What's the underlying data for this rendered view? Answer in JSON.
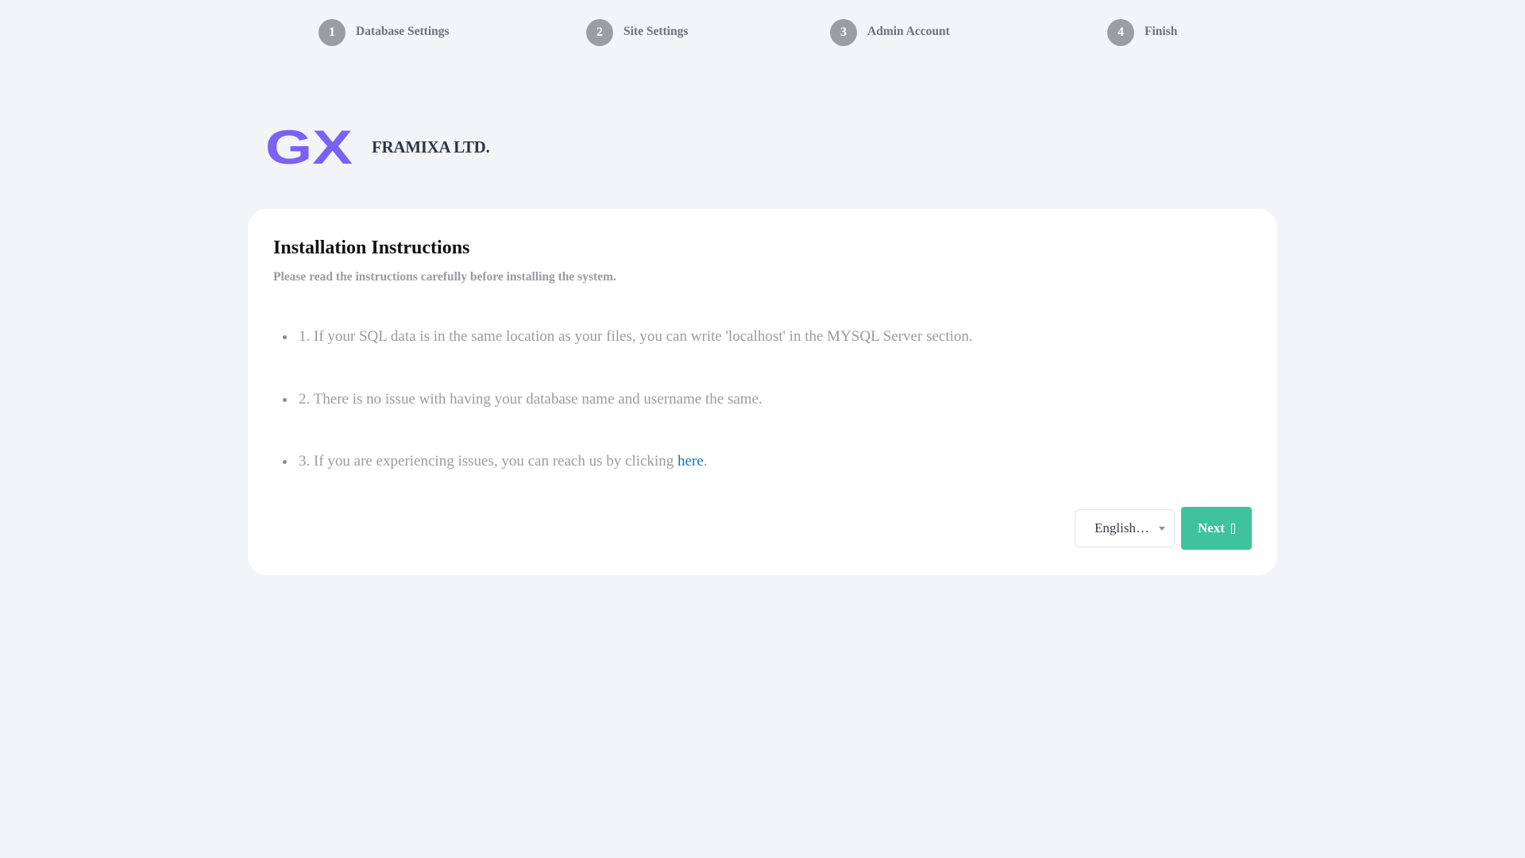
{
  "steps": [
    {
      "number": "1",
      "label": "Database Settings"
    },
    {
      "number": "2",
      "label": "Site Settings"
    },
    {
      "number": "3",
      "label": "Admin Account"
    },
    {
      "number": "4",
      "label": "Finish"
    }
  ],
  "brand": {
    "logo_text": "GX",
    "name": "FRAMIXA LTD.",
    "logo_color": "#7b61f5"
  },
  "card": {
    "title": "Installation Instructions",
    "subtitle": "Please read the instructions carefully before installing the system.",
    "instructions": [
      {
        "text": "1. If your SQL data is in the same location as your files, you can write 'localhost' in the MYSQL Server section."
      },
      {
        "text": "2. There is no issue with having your database name and username the same."
      },
      {
        "text": "3. If you are experiencing issues, you can reach us by clicking ",
        "link_text": "here",
        "suffix": "."
      }
    ]
  },
  "footer": {
    "language_selected": "English…",
    "next_label": "Next"
  },
  "colors": {
    "background": "#f3f4f8",
    "step_badge": "#9b9da3",
    "accent_green": "#3ec39a",
    "link_blue": "#1a6fc7"
  }
}
